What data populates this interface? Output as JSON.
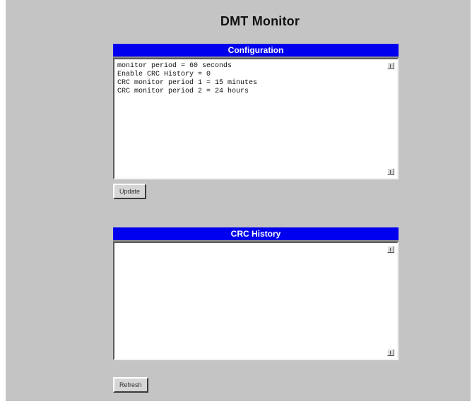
{
  "title": "DMT Monitor",
  "configuration": {
    "header": "Configuration",
    "text": "monitor period = 60 seconds\nEnable CRC History = 0\nCRC monitor period 1 = 15 minutes\nCRC monitor period 2 = 24 hours",
    "button_label": "Update"
  },
  "crc_history": {
    "header": "CRC History",
    "text": "",
    "button_label": "Refresh"
  }
}
